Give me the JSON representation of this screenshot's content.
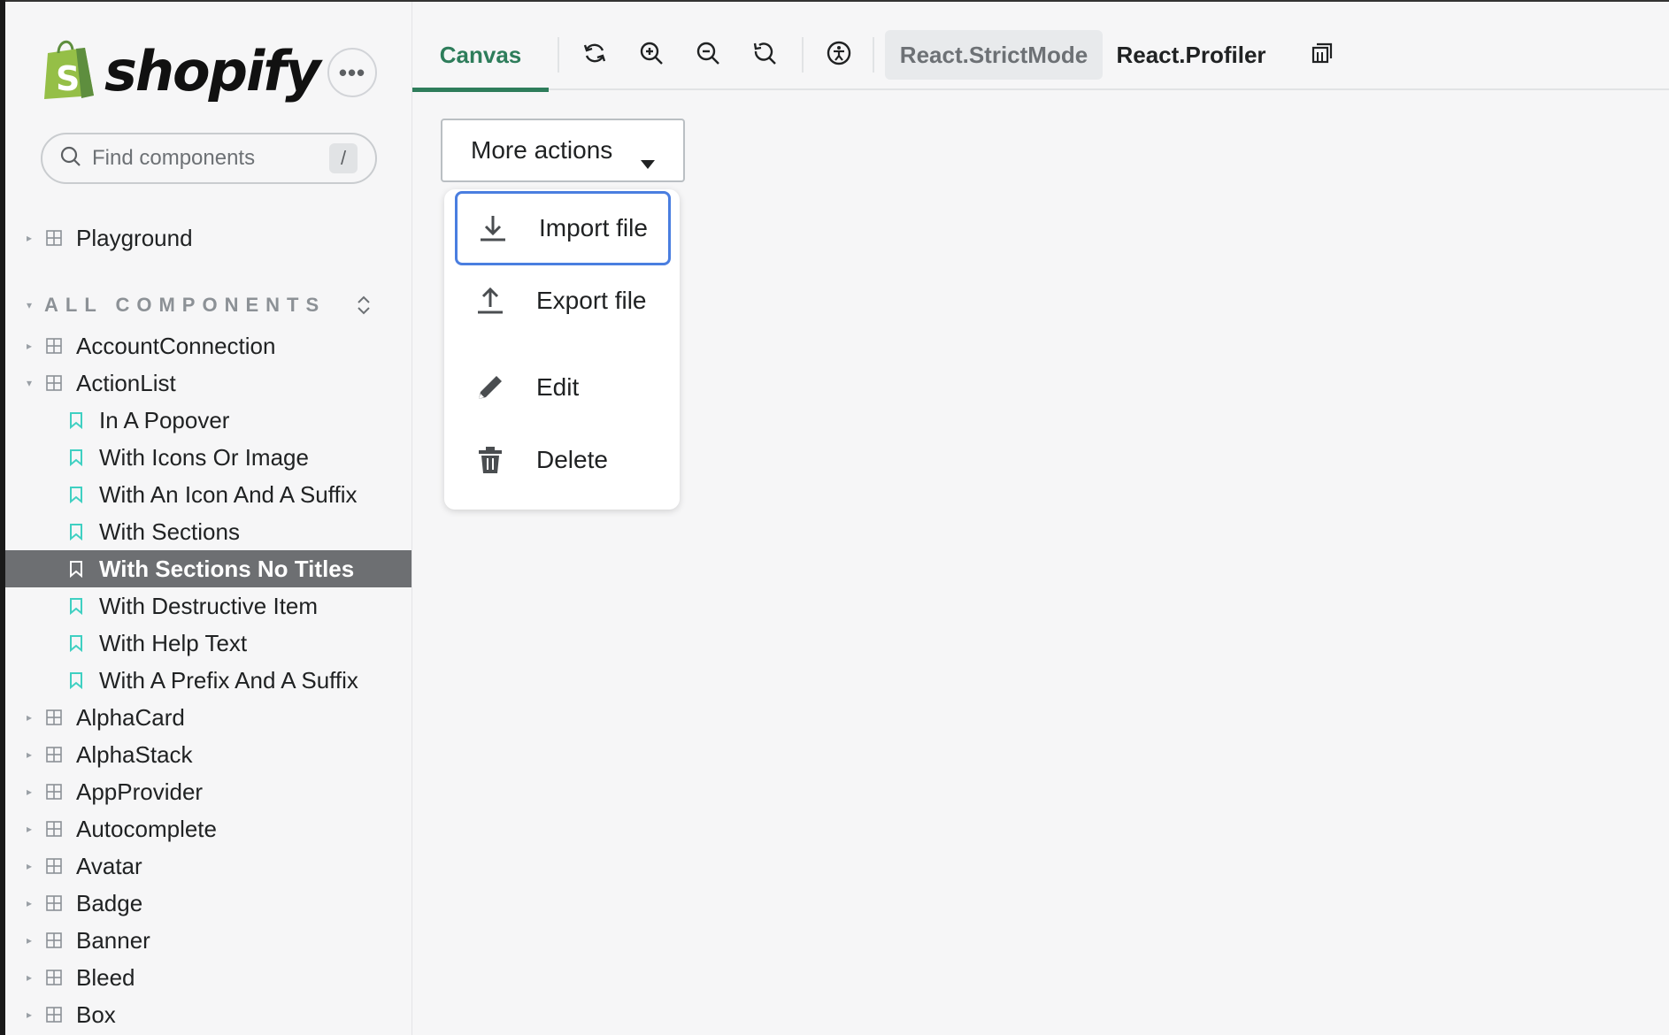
{
  "sidebar": {
    "brand": "shopify",
    "more_icon": "ellipsis-icon",
    "search": {
      "placeholder": "Find components",
      "shortcut": "/"
    },
    "playground": "Playground",
    "section_label": "ALL COMPONENTS",
    "components": [
      {
        "label": "AccountConnection",
        "expanded": false
      },
      {
        "label": "ActionList",
        "expanded": true
      }
    ],
    "stories": [
      "In A Popover",
      "With Icons Or Image",
      "With An Icon And A Suffix",
      "With Sections",
      "With Sections No Titles",
      "With Destructive Item",
      "With Help Text",
      "With A Prefix And A Suffix"
    ],
    "selected_story": "With Sections No Titles",
    "more_components": [
      "AlphaCard",
      "AlphaStack",
      "AppProvider",
      "Autocomplete",
      "Avatar",
      "Badge",
      "Banner",
      "Bleed",
      "Box"
    ]
  },
  "toolbar": {
    "active_tab": "Canvas",
    "tools": [
      "refresh-icon",
      "zoom-in-icon",
      "zoom-out-icon",
      "reset-zoom-icon",
      "accessibility-icon"
    ],
    "strict_mode": "React.StrictMode",
    "profiler": "React.Profiler",
    "outline_icon": "outline-icon"
  },
  "canvas": {
    "button_label": "More actions",
    "menu": [
      {
        "label": "Import file",
        "icon": "download-icon",
        "focused": true
      },
      {
        "label": "Export file",
        "icon": "upload-icon",
        "focused": false
      },
      {
        "label": "Edit",
        "icon": "pencil-icon",
        "focused": false
      },
      {
        "label": "Delete",
        "icon": "trash-icon",
        "focused": false
      }
    ]
  },
  "colors": {
    "accent_green": "#2e7d5b",
    "selected_bg": "#6d6f72",
    "story_icon": "#3fd0c2",
    "focus_ring": "#4a7ee0"
  }
}
